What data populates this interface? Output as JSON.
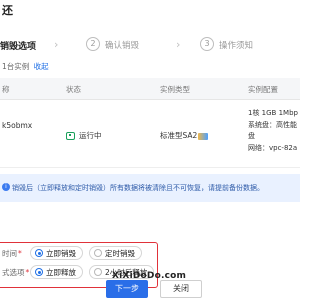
{
  "dialog": {
    "title": "还"
  },
  "steps": {
    "active_label": "销毁选项",
    "sep": "›",
    "items": [
      {
        "num": "2",
        "label": "确认销毁"
      },
      {
        "num": "3",
        "label": "操作须知"
      }
    ]
  },
  "selection": {
    "summary": "1台实例",
    "collapse": "收起"
  },
  "table": {
    "headers": [
      "称",
      "状态",
      "实例类型",
      "实例配置"
    ],
    "row": {
      "name": "k5obmx",
      "status": "运行中",
      "type": "标准型SA2",
      "config": [
        "1核 1GB 1Mbp",
        "系统盘：高性能",
        "盘",
        "网络：vpc-82a"
      ]
    }
  },
  "notice": {
    "icon": "info-icon",
    "text": "销毁后（立即释放和定时销毁）所有数据将被清除且不可恢复，请提前备份数据。"
  },
  "form": {
    "rows": [
      {
        "label": "时间",
        "options": [
          {
            "label": "立即销毁",
            "checked": true
          },
          {
            "label": "定时销毁",
            "checked": false
          }
        ]
      },
      {
        "label": "式选项",
        "options": [
          {
            "label": "立即释放",
            "checked": true
          },
          {
            "label": "2小时后释放",
            "checked": false
          }
        ]
      }
    ],
    "required_mark": "*"
  },
  "watermark": "XiXiDoDo.com",
  "buttons": {
    "next": "下一步",
    "close": "关闭"
  },
  "colors": {
    "primary": "#2a6ee8",
    "danger": "#e0323a",
    "success": "#1aa05a",
    "notice_bg": "#e9f1ff"
  }
}
